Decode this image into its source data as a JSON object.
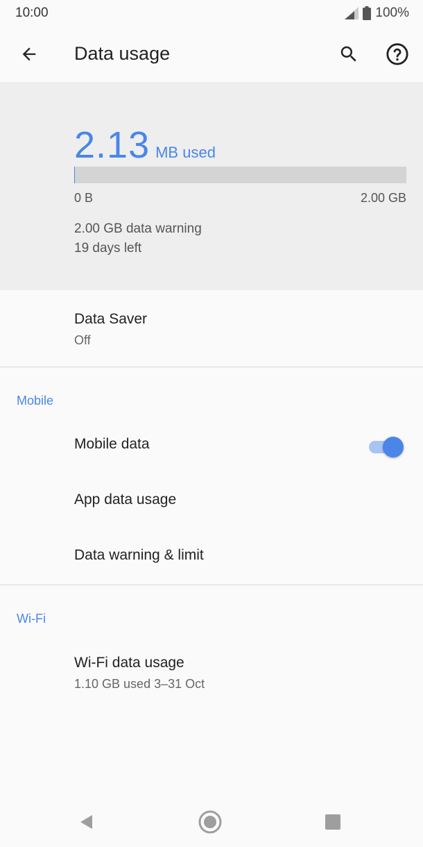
{
  "status_bar": {
    "time": "10:00",
    "battery": "100%"
  },
  "app_bar": {
    "title": "Data usage"
  },
  "summary": {
    "amount": "2.13",
    "unit": "MB used",
    "bar_min": "0 B",
    "bar_max": "2.00 GB",
    "progress_fraction": 0.001,
    "warning": "2.00 GB data warning",
    "days_left": "19 days left"
  },
  "data_saver": {
    "title": "Data Saver",
    "status": "Off"
  },
  "mobile": {
    "header": "Mobile",
    "mobile_data_label": "Mobile data",
    "mobile_data_on": true,
    "app_data_usage_label": "App data usage",
    "warning_limit_label": "Data warning & limit"
  },
  "wifi": {
    "header": "Wi-Fi",
    "usage_title": "Wi-Fi data usage",
    "usage_detail": "1.10 GB used 3–31 Oct"
  },
  "colors": {
    "accent": "#4a86e8",
    "summary_bg": "#eeeeee",
    "bar_bg": "#d4d4d4"
  },
  "icons": [
    "cellular-signal-icon",
    "battery-icon",
    "back-arrow-icon",
    "search-icon",
    "help-icon",
    "nav-back-icon",
    "nav-home-icon",
    "nav-recents-icon"
  ]
}
